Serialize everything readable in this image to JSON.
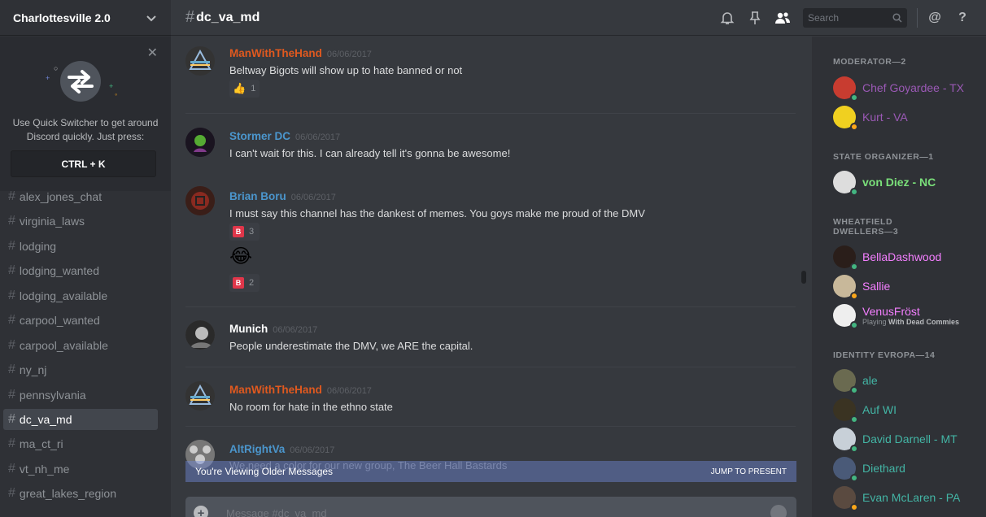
{
  "colors": {
    "green_status": "#43b581",
    "idle_status": "#faa61a",
    "orange_name": "#e0591f",
    "blue_name": "#4b96cd",
    "purple_name": "#9b59b6",
    "light_green_name": "#7adf7a",
    "pink_name": "#f47fff",
    "teal_name": "#43b5a5"
  },
  "server": {
    "name": "Charlottesville 2.0"
  },
  "quick_switcher": {
    "text": "Use Quick Switcher to get around Discord quickly. Just press:",
    "shortcut": "CTRL + K"
  },
  "channels": [
    {
      "name": "alex_jones_chat"
    },
    {
      "name": "virginia_laws"
    },
    {
      "name": "lodging"
    },
    {
      "name": "lodging_wanted"
    },
    {
      "name": "lodging_available"
    },
    {
      "name": "carpool_wanted"
    },
    {
      "name": "carpool_available"
    },
    {
      "name": "ny_nj"
    },
    {
      "name": "pennsylvania"
    },
    {
      "name": "dc_va_md"
    },
    {
      "name": "ma_ct_ri"
    },
    {
      "name": "vt_nh_me"
    },
    {
      "name": "great_lakes_region"
    }
  ],
  "header": {
    "hash": "#",
    "channel": "dc_va_md",
    "search_placeholder": "Search"
  },
  "messages": [
    {
      "author": "ManWithTheHand",
      "date": "06/06/2017",
      "text": "Beltway Bigots will show up to hate banned or not"
    },
    {
      "author": "Stormer DC",
      "date": "06/06/2017",
      "text": "I can't wait for this. I can already tell it's gonna be awesome!"
    },
    {
      "author": "Brian Boru",
      "date": "06/06/2017",
      "text": "I must say this channel has the dankest of memes. You goys make me proud of the DMV"
    },
    {
      "author": "Munich",
      "date": "06/06/2017",
      "text": "People underestimate the DMV, we ARE the capital."
    },
    {
      "author": "ManWithTheHand",
      "date": "06/06/2017",
      "text": "No room for hate in the ethno state"
    },
    {
      "author": "AltRightVa",
      "date": "06/06/2017",
      "text": "We need a color for our new group, The Beer Hall Bastards"
    }
  ],
  "reactions": {
    "thumbs": "1",
    "b_first": "3",
    "b_second": "2",
    "b_letter": "B",
    "laugh_emoji": "😂"
  },
  "older_bar": {
    "label": "You're Viewing Older Messages",
    "jump": "JUMP TO PRESENT"
  },
  "composer": {
    "placeholder": "Message #dc_va_md",
    "plus": "+"
  },
  "members": {
    "roles": [
      "MODERATOR—2",
      "STATE ORGANIZER—1",
      "WHEATFIELD DWELLERS—3",
      "IDENTITY EVROPA—14"
    ],
    "people": [
      {
        "name": "Chef Goyardee - TX"
      },
      {
        "name": "Kurt - VA"
      },
      {
        "name": "von Diez - NC"
      },
      {
        "name": "BellaDashwood"
      },
      {
        "name": "Sallie"
      },
      {
        "name": "VenusFröst",
        "playing_prefix": "Playing",
        "game": "With Dead Commies"
      },
      {
        "name": "ale"
      },
      {
        "name": "Auf WI"
      },
      {
        "name": "David Darnell - MT"
      },
      {
        "name": "Diethard"
      },
      {
        "name": "Evan McLaren - PA"
      }
    ]
  }
}
